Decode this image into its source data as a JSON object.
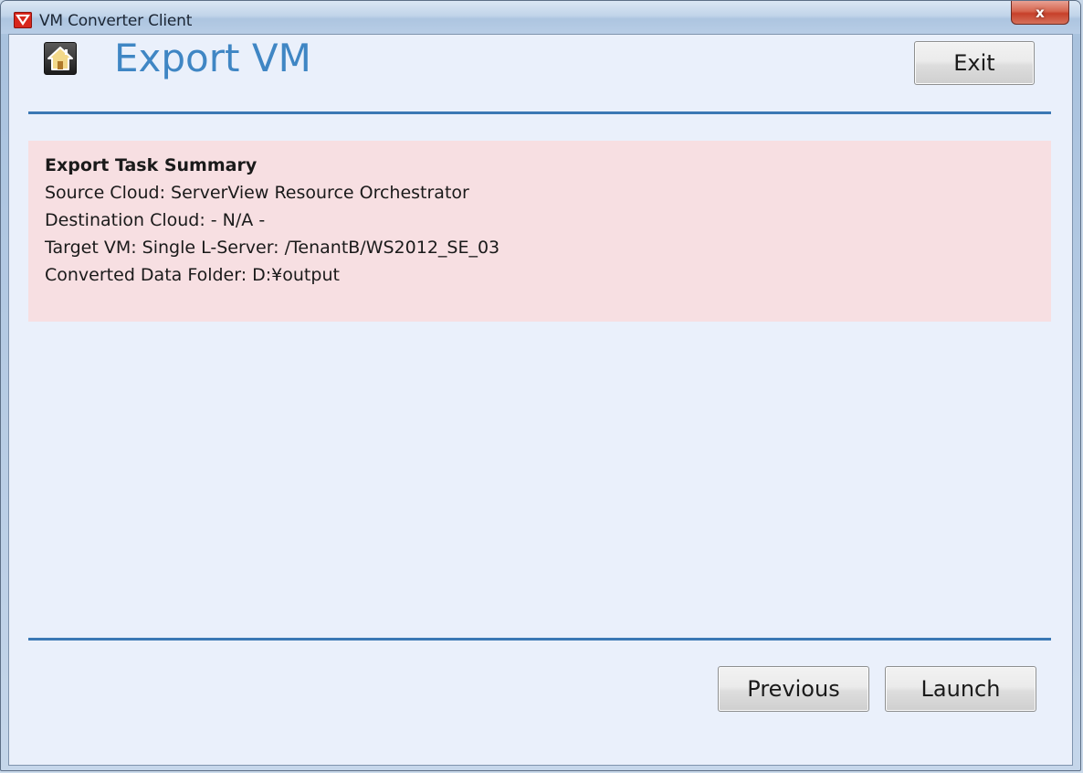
{
  "window": {
    "title": "VM Converter Client",
    "close_label": "x",
    "app_icon": "vm-converter-app-icon"
  },
  "header": {
    "home_icon": "home-icon",
    "title": "Export VM",
    "exit_label": "Exit"
  },
  "summary": {
    "heading": "Export Task Summary",
    "lines": [
      "Source Cloud: ServerView Resource Orchestrator",
      "Destination Cloud: - N/A -",
      "Target VM: Single L-Server: /TenantB/WS2012_SE_03",
      "Converted Data Folder: D:¥output"
    ]
  },
  "footer": {
    "previous_label": "Previous",
    "launch_label": "Launch"
  },
  "colors": {
    "title_blue": "#3f86c4",
    "divider_blue": "#3b78b4",
    "summary_background": "#f7dfe2",
    "client_background": "#eaf0fb"
  }
}
